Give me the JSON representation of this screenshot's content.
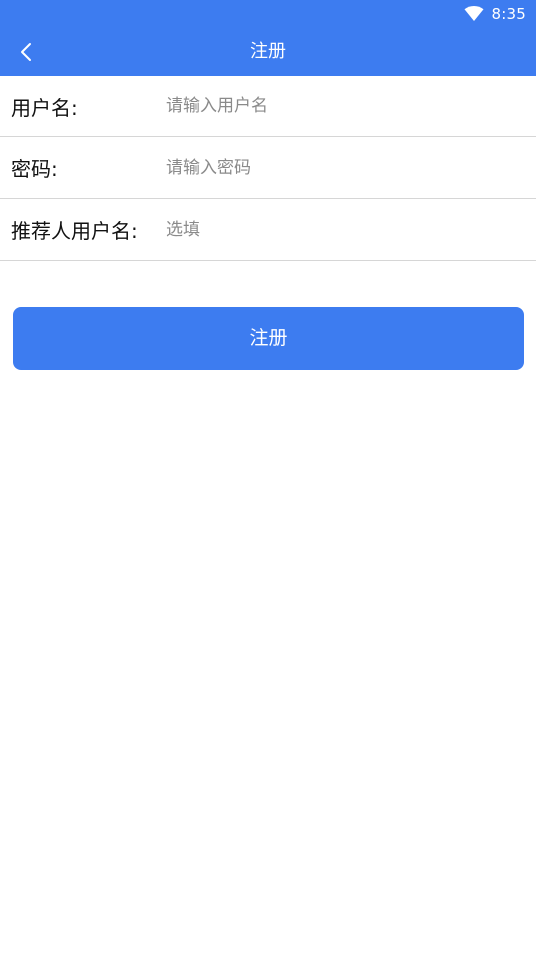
{
  "status_bar": {
    "time": "8:35",
    "icons": [
      "wifi-icon"
    ]
  },
  "header": {
    "title": "注册",
    "back_icon": "chevron-left-icon"
  },
  "form": {
    "fields": [
      {
        "label": "用户名:",
        "placeholder": "请输入用户名",
        "value": ""
      },
      {
        "label": "密码:",
        "placeholder": "请输入密码",
        "value": ""
      },
      {
        "label": "推荐人用户名:",
        "placeholder": "选填",
        "value": ""
      }
    ],
    "submit_label": "注册"
  },
  "colors": {
    "accent": "#3d7cf0",
    "divider": "#d6d6d6",
    "placeholder": "#8a8a8a"
  }
}
